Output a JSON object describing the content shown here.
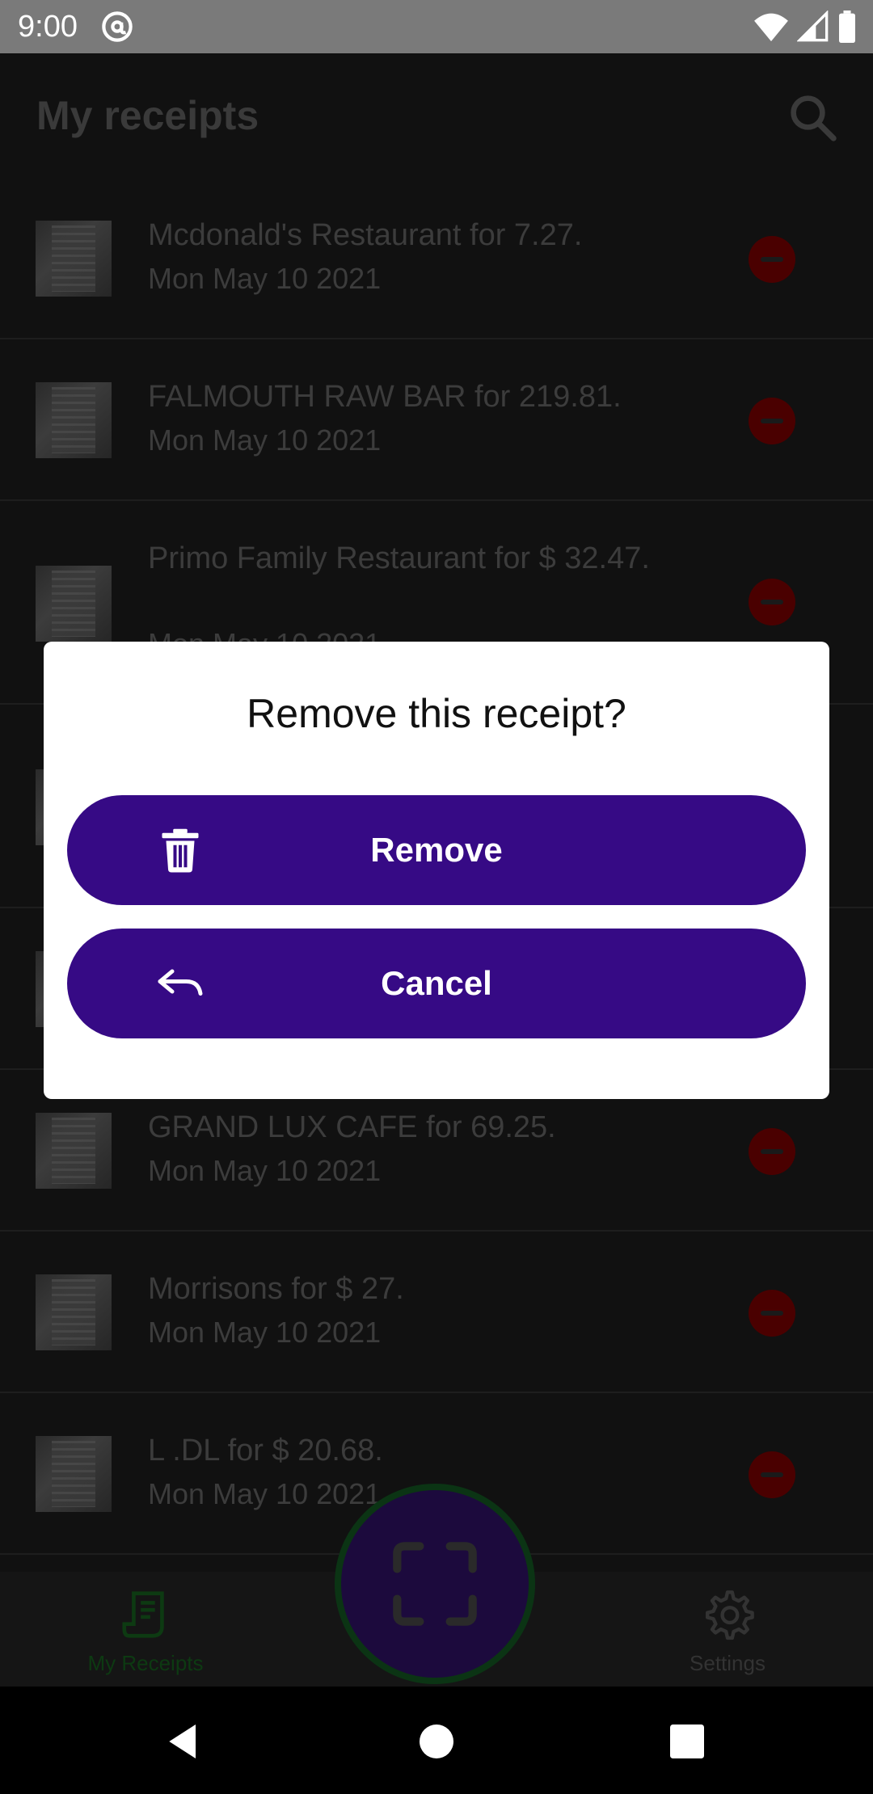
{
  "status_bar": {
    "time": "9:00",
    "icons": [
      "at-sign-icon",
      "wifi-icon",
      "signal-icon",
      "battery-icon"
    ]
  },
  "app_bar": {
    "title": "My receipts",
    "search_icon": "search-icon"
  },
  "receipts": [
    {
      "title": "Mcdonald's Restaurant for 7.27.",
      "date": "Mon May 10 2021"
    },
    {
      "title": "FALMOUTH RAW BAR for 219.81.",
      "date": "Mon May 10 2021"
    },
    {
      "title": "Primo Family Restaurant for $ 32.47.",
      "date": "Mon May 10 2021"
    },
    {
      "title": "",
      "date": ""
    },
    {
      "title": "",
      "date": ""
    },
    {
      "title": "GRAND LUX CAFE for 69.25.",
      "date": "Mon May 10 2021"
    },
    {
      "title": "Morrisons for $ 27.",
      "date": "Mon May 10 2021"
    },
    {
      "title": "L .DL for $ 20.68.",
      "date": "Mon May 10 2021"
    }
  ],
  "bottom_nav": {
    "receipts_label": "My Receipts",
    "settings_label": "Settings"
  },
  "dialog": {
    "title": "Remove this receipt?",
    "remove_label": "Remove",
    "cancel_label": "Cancel"
  },
  "colors": {
    "accent_purple": "#360a85",
    "dialog_bg": "#ffffff",
    "nav_active_green": "#0d3a12"
  }
}
